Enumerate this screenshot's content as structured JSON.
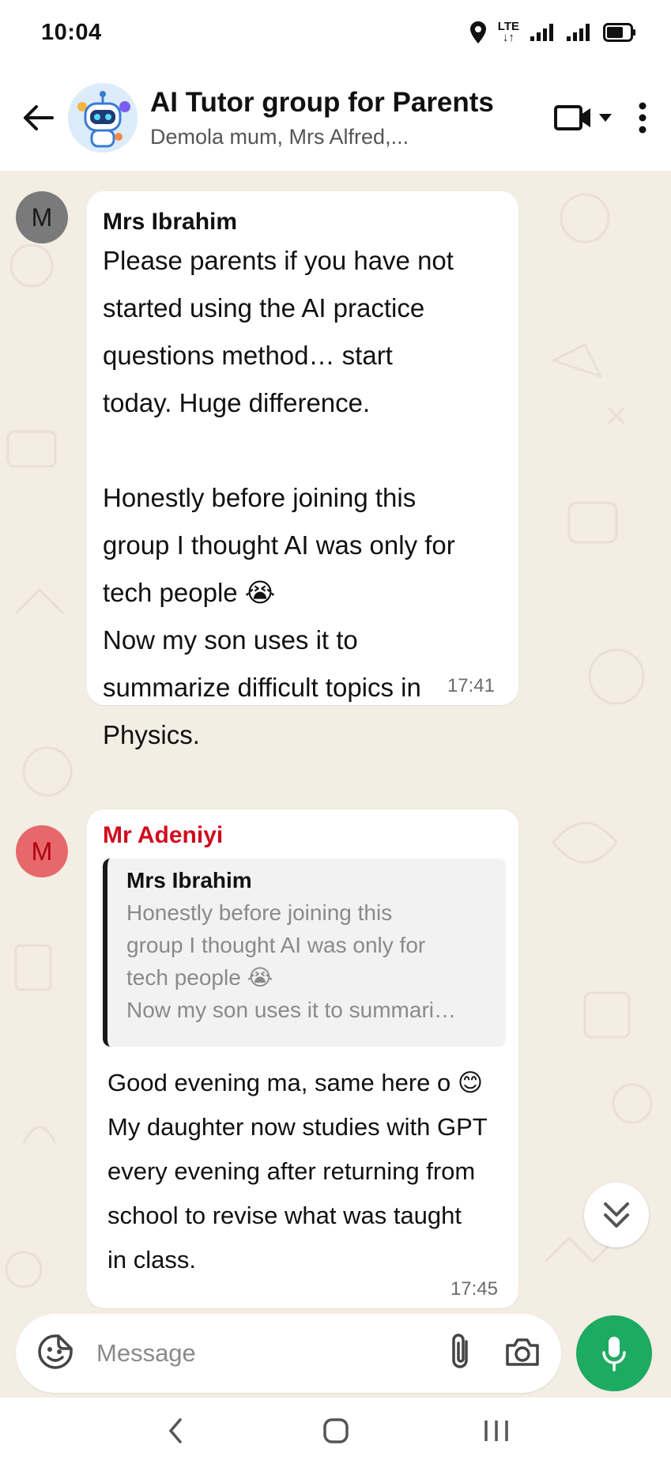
{
  "status_bar": {
    "time": "10:04",
    "network": "LTE"
  },
  "header": {
    "title": "AI Tutor group for Parents",
    "members": "Demola mum, Mrs Alfred,..."
  },
  "messages": [
    {
      "avatar_letter": "M",
      "sender": "Mrs Ibrahim",
      "text": "Please parents if you have not\nstarted using the AI practice\nquestions method… start\ntoday. Huge difference.\n\nHonestly before joining this\ngroup I thought AI was only for\ntech people 😭\nNow my son uses it to\nsummarize difficult topics in\nPhysics.",
      "time": "17:41"
    },
    {
      "avatar_letter": "M",
      "sender": "Mr Adeniyi",
      "quote": {
        "sender": "Mrs Ibrahim",
        "text": "Honestly before joining this\ngroup I thought AI was only for\ntech people 😭\nNow my son uses it to summari…"
      },
      "text": "Good evening ma, same here o 😊\nMy daughter now studies with GPT\nevery evening after returning from\nschool to revise what was taught\nin class.",
      "time": "17:45"
    }
  ],
  "composer": {
    "placeholder": "Message"
  },
  "colors": {
    "accent_green": "#1daa61",
    "sender_red": "#d10b1d",
    "chat_background": "#f3ede4"
  }
}
